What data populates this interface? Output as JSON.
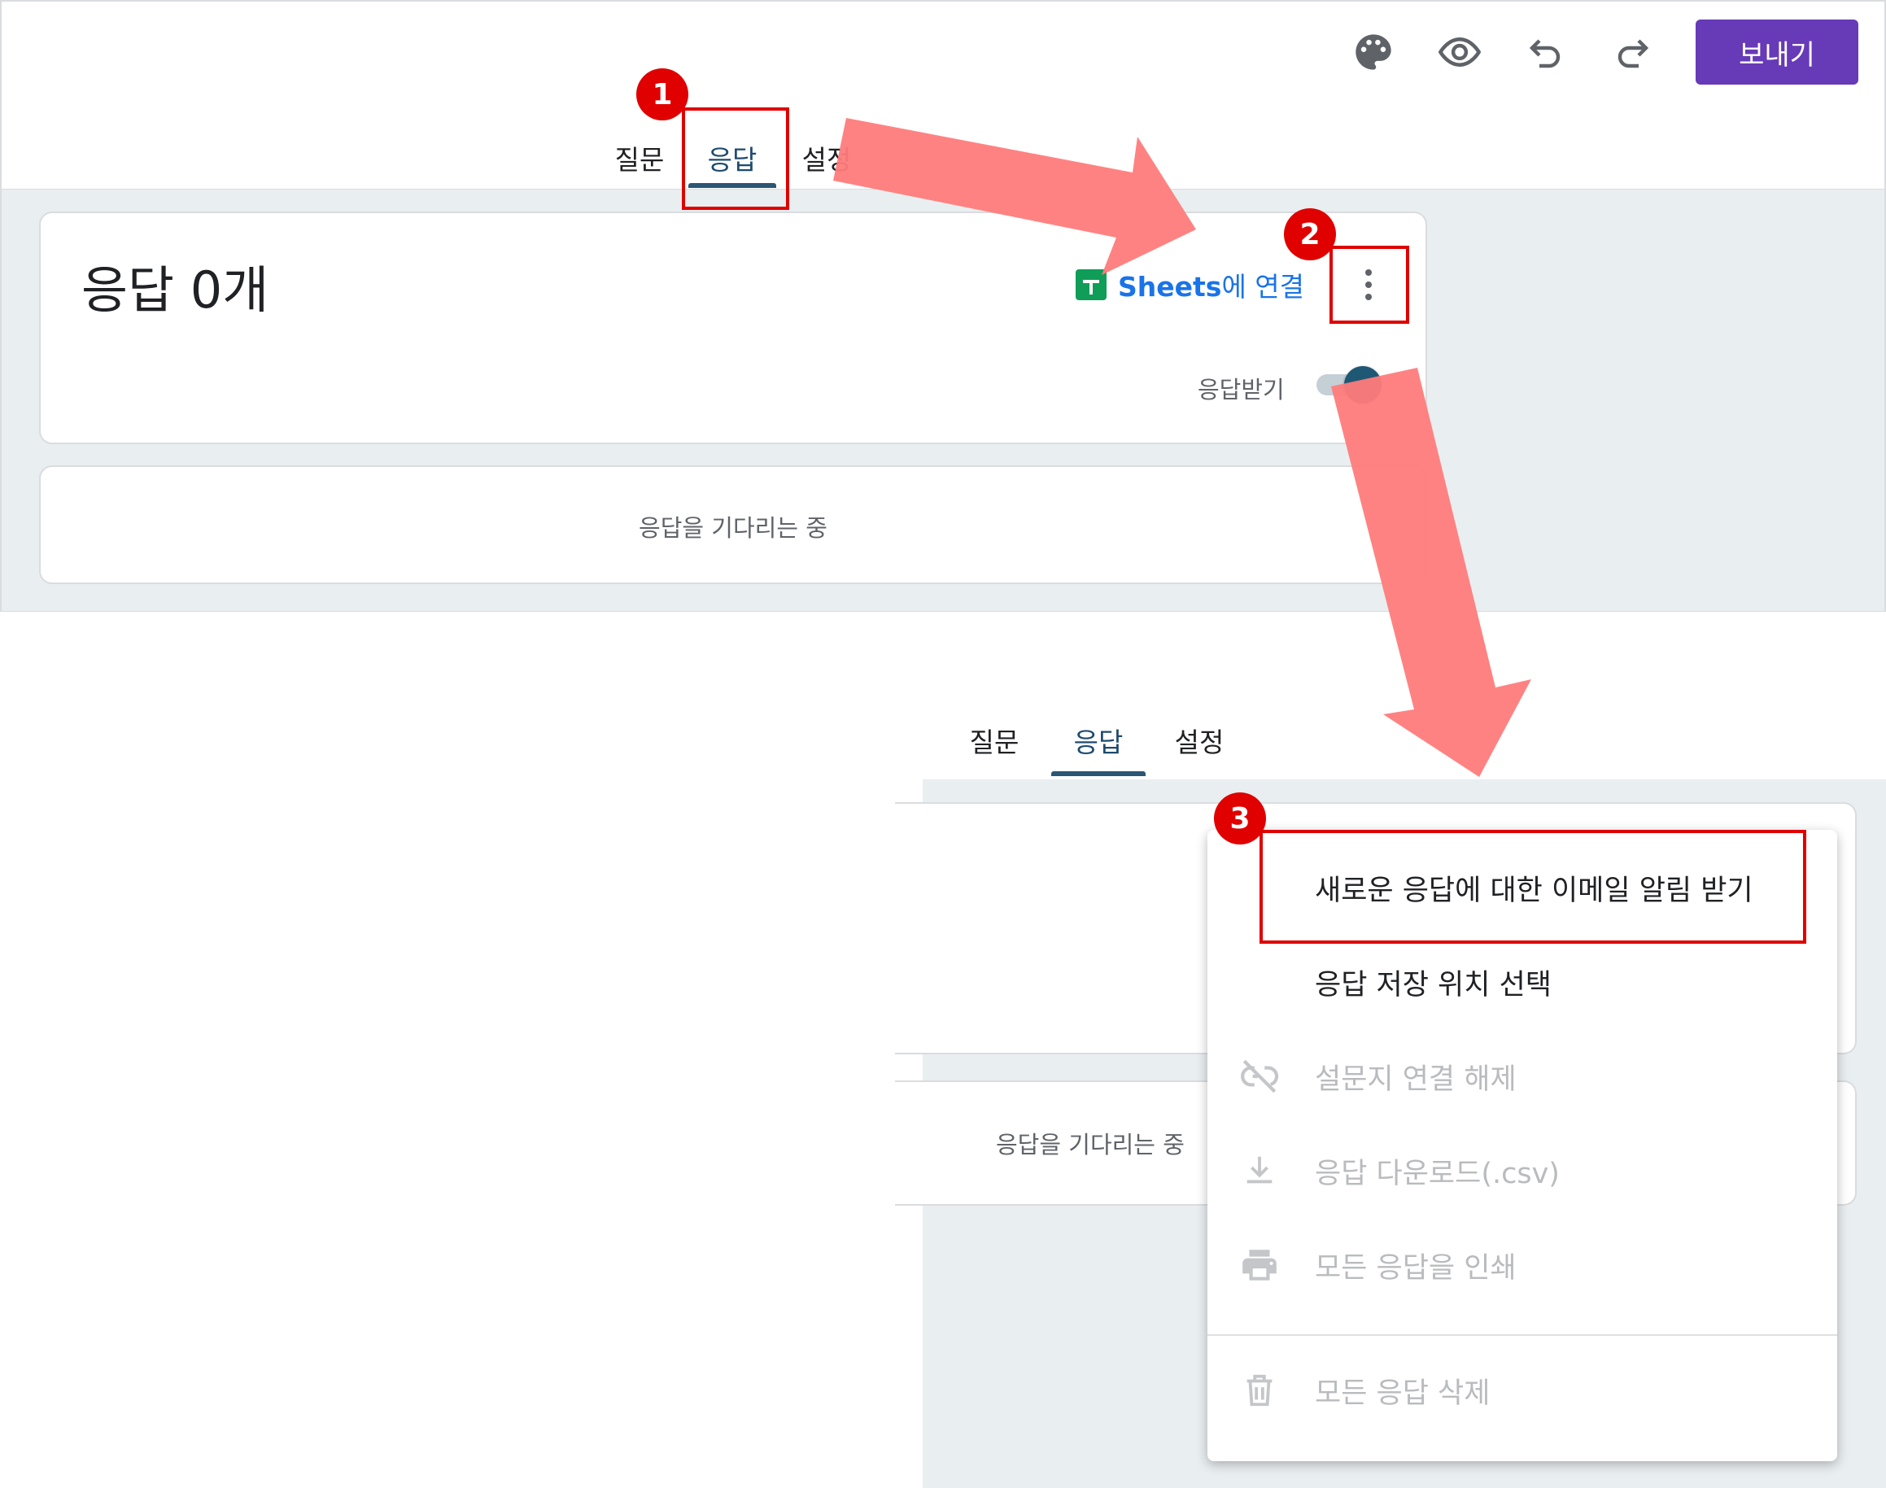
{
  "top": {
    "toolbar": {
      "palette_icon": "palette-icon",
      "preview_icon": "eye-icon",
      "undo_icon": "undo-icon",
      "redo_icon": "redo-icon",
      "send_label": "보내기"
    },
    "tabs": [
      {
        "label": "질문",
        "active": false
      },
      {
        "label": "응답",
        "active": true
      },
      {
        "label": "설정",
        "active": false
      }
    ],
    "summary": {
      "title": "응답 0개",
      "sheets_link_strong": "Sheets",
      "sheets_link_rest": "에 연결",
      "accepting_label": "응답받기",
      "accepting_on": true
    },
    "waiting_text": "응답을 기다리는 중"
  },
  "bottom": {
    "tabs": [
      {
        "label": "질문",
        "active": false
      },
      {
        "label": "응답",
        "active": true
      },
      {
        "label": "설정",
        "active": false
      }
    ],
    "waiting_text": "응답을 기다리는 중",
    "menu": [
      {
        "label": "새로운 응답에 대한 이메일 알림 받기",
        "icon": "",
        "enabled": true
      },
      {
        "label": "응답 저장 위치 선택",
        "icon": "",
        "enabled": true
      },
      {
        "label": "설문지 연결 해제",
        "icon": "link-off-icon",
        "enabled": false
      },
      {
        "label": "응답 다운로드(.csv)",
        "icon": "download-icon",
        "enabled": false
      },
      {
        "label": "모든 응답을 인쇄",
        "icon": "print-icon",
        "enabled": false
      },
      {
        "label": "모든 응답 삭제",
        "icon": "trash-icon",
        "enabled": false
      }
    ]
  },
  "annotations": {
    "step1": "1",
    "step2": "2",
    "step3": "3",
    "color": "#e00000",
    "arrow_color": "#ff7b7b"
  },
  "colors": {
    "accent": "#673ab7",
    "tab_active": "#1e4a6e",
    "link": "#1a73e8",
    "page_bg": "#e9eef0"
  }
}
